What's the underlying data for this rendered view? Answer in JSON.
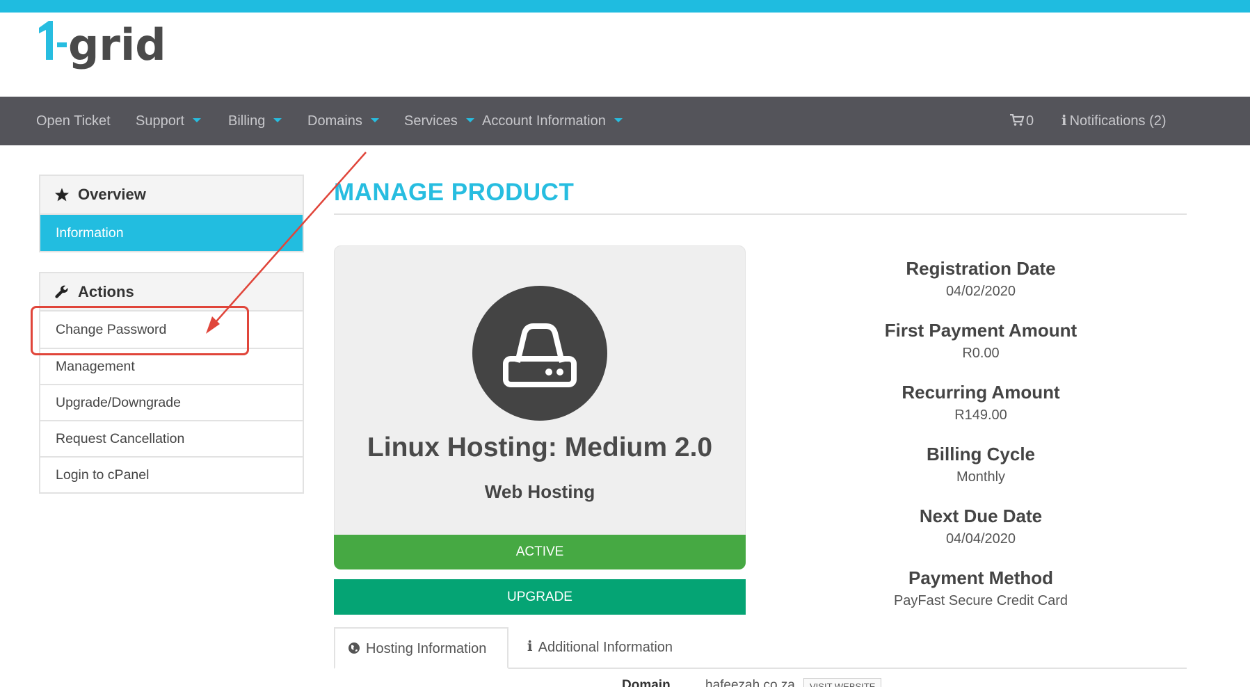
{
  "brand": {
    "logo_text": "1-grid"
  },
  "navbar": {
    "items": [
      {
        "label": "Open Ticket",
        "has_caret": false
      },
      {
        "label": "Support",
        "has_caret": true
      },
      {
        "label": "Billing",
        "has_caret": true
      },
      {
        "label": "Domains",
        "has_caret": true
      },
      {
        "label": "Services",
        "has_caret": true
      },
      {
        "label": "Account Information",
        "has_caret": true
      }
    ],
    "cart": {
      "icon": "shopping-cart-icon",
      "count": "0"
    },
    "notifications": {
      "icon": "info-icon",
      "label": "Notifications (2)"
    }
  },
  "sidebar": {
    "overview": {
      "title": "Overview",
      "icon": "star-icon",
      "items": [
        {
          "label": "Information",
          "active": true
        }
      ]
    },
    "actions": {
      "title": "Actions",
      "icon": "wrench-icon",
      "items": [
        {
          "label": "Change Password"
        },
        {
          "label": "Management"
        },
        {
          "label": "Upgrade/Downgrade"
        },
        {
          "label": "Request Cancellation"
        },
        {
          "label": "Login to cPanel"
        }
      ]
    }
  },
  "main": {
    "heading": "MANAGE PRODUCT",
    "product": {
      "icon": "hard-drive-icon",
      "name": "Linux Hosting: Medium 2.0",
      "group": "Web Hosting",
      "status": "ACTIVE",
      "upgrade_label": "UPGRADE"
    },
    "details": [
      {
        "label": "Registration Date",
        "value": "04/02/2020"
      },
      {
        "label": "First Payment Amount",
        "value": "R0.00"
      },
      {
        "label": "Recurring Amount",
        "value": "R149.00"
      },
      {
        "label": "Billing Cycle",
        "value": "Monthly"
      },
      {
        "label": "Next Due Date",
        "value": "04/04/2020"
      },
      {
        "label": "Payment Method",
        "value": "PayFast Secure Credit Card"
      }
    ],
    "tabs": [
      {
        "label": "Hosting Information",
        "icon": "globe-icon",
        "active": true
      },
      {
        "label": "Additional Information",
        "icon": "info-icon",
        "active": false
      }
    ],
    "tab_content": {
      "domain_label": "Domain",
      "domain_value": "hafeezah.co.za",
      "visit_button": "VISIT WEBSITE"
    }
  },
  "colors": {
    "accent": "#1fbce0",
    "navbar": "#54545a",
    "status_active": "#46a943",
    "upgrade": "#05a474",
    "annotation": "#e0453a"
  }
}
